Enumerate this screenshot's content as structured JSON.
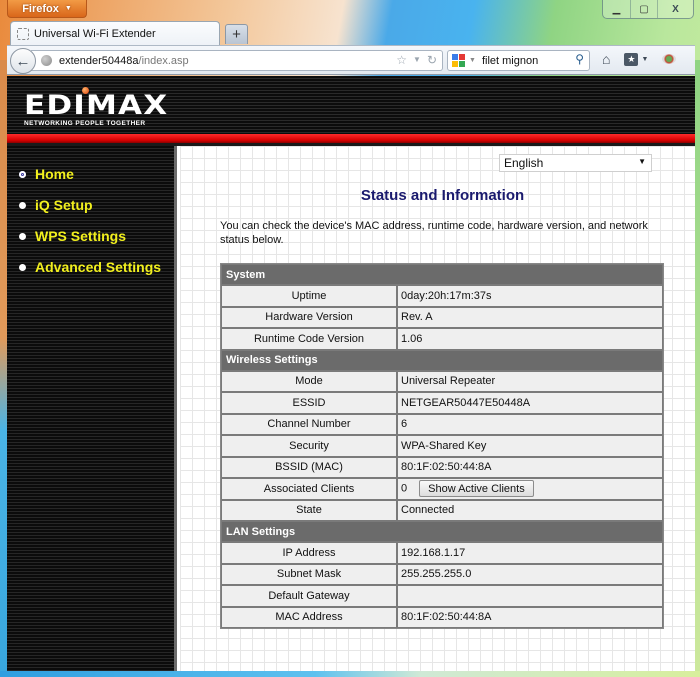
{
  "browser": {
    "menu_button": "Firefox",
    "tab_title": "Universal Wi-Fi Extender",
    "new_tab": "+",
    "url_host": "extender50448a",
    "url_path": "/index.asp",
    "search_value": "filet mignon",
    "window_controls": {
      "minimize": "▁",
      "maximize": "▢",
      "close": "X"
    },
    "icons": [
      "back-icon",
      "site-identity-icon",
      "bookmark-star-icon",
      "dropdown-icon",
      "reload-icon",
      "google-icon",
      "search-icon",
      "home-icon",
      "bookmarks-icon",
      "addon-eye-icon"
    ]
  },
  "brand": {
    "name": "EDIMAX",
    "tagline": "NETWORKING PEOPLE TOGETHER",
    "accent_red": "#e00000",
    "nav_text_color": "#f2f01e",
    "title_color": "#1a1a6e"
  },
  "sidebar": {
    "items": [
      {
        "label": "Home",
        "active": true
      },
      {
        "label": "iQ Setup",
        "active": false
      },
      {
        "label": "WPS Settings",
        "active": false
      },
      {
        "label": "Advanced Settings",
        "active": false
      }
    ]
  },
  "main": {
    "language_select": "English",
    "title": "Status and Information",
    "description": "You can check the device's MAC address, runtime code, hardware version, and network status below.",
    "sections": [
      {
        "title": "System",
        "rows": [
          {
            "label": "Uptime",
            "value": "0day:20h:17m:37s"
          },
          {
            "label": "Hardware Version",
            "value": "Rev. A"
          },
          {
            "label": "Runtime Code Version",
            "value": "1.06"
          }
        ]
      },
      {
        "title": "Wireless Settings",
        "rows": [
          {
            "label": "Mode",
            "value": "Universal Repeater"
          },
          {
            "label": "ESSID",
            "value": "NETGEAR50447E50448A"
          },
          {
            "label": "Channel Number",
            "value": "6"
          },
          {
            "label": "Security",
            "value": "WPA-Shared Key"
          },
          {
            "label": "BSSID (MAC)",
            "value": "80:1F:02:50:44:8A"
          },
          {
            "label": "Associated Clients",
            "value": "0",
            "button": "Show Active Clients"
          },
          {
            "label": "State",
            "value": "Connected"
          }
        ]
      },
      {
        "title": "LAN Settings",
        "rows": [
          {
            "label": "IP Address",
            "value": "192.168.1.17"
          },
          {
            "label": "Subnet Mask",
            "value": "255.255.255.0"
          },
          {
            "label": "Default Gateway",
            "value": ""
          },
          {
            "label": "MAC Address",
            "value": "80:1F:02:50:44:8A"
          }
        ]
      }
    ]
  }
}
